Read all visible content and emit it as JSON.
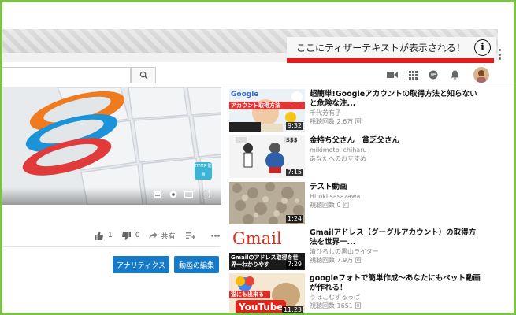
{
  "teaser": {
    "text": "ここにティザーテキストが表示される！",
    "info_glyph": "i"
  },
  "topbar": {
    "icons": [
      "search-icon",
      "video-camera-icon",
      "apps-grid-icon",
      "chat-icon",
      "bell-icon",
      "avatar"
    ]
  },
  "player": {
    "watermark": "ПУМЯ 動画"
  },
  "actions": {
    "likes": "1",
    "dislikes": "0",
    "share_label": "共有"
  },
  "buttons": {
    "analytics": "アナリティクス",
    "edit_video": "動画の編集"
  },
  "recommendations": [
    {
      "title": "超簡単!Googleアカウントの取得方法と知らないと危険な注...",
      "channel": "千代芳有子",
      "meta": "視聴回数 2.6万 回",
      "duration": "9:32",
      "thumb_text_top": "Google",
      "thumb_text_mid": "アカウント取得方法"
    },
    {
      "title": "金持ち父さん　貧乏父さん",
      "channel": "mikimoto. chiharu",
      "meta": "あなたへのおすすめ",
      "duration": "7:15",
      "thumb_text_top": "$$$"
    },
    {
      "title": "テスト動画",
      "channel": "Hiroki sasazawa",
      "meta": "視聴回数 0 回",
      "duration": "1:24"
    },
    {
      "title": "Gmailアドレス（グーグルアカウント）の取得方法を世界一...",
      "channel": "清ひろしの黒山ライター",
      "meta": "視聴回数 7.9万 回",
      "duration": "7:29",
      "thumb_text_top": "Gmail",
      "thumb_text_mid": "Gmailのアドレス取得を世界一わかりやす"
    },
    {
      "title": "googleフォトで簡単作成～あなたにもペット動画が作れる！",
      "channel": "うほこむずるっぱ",
      "meta": "視聴回数 1651 回",
      "duration": "11:23",
      "thumb_text_top": "猫にも出来る",
      "thumb_text_mid": "YouTube"
    }
  ],
  "colors": {
    "frame": "#7cc24a",
    "teaser_bar": "#e31b1b",
    "button_blue": "#167ac6"
  }
}
